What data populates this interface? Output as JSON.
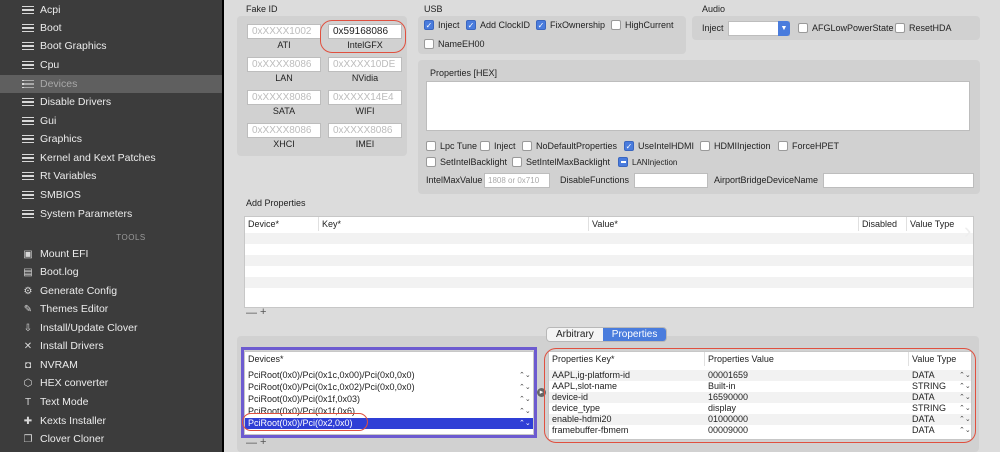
{
  "sidebar": {
    "items": [
      {
        "label": "Acpi",
        "icon": "list-icon"
      },
      {
        "label": "Boot",
        "icon": "list-icon"
      },
      {
        "label": "Boot Graphics",
        "icon": "list-icon"
      },
      {
        "label": "Cpu",
        "icon": "list-icon"
      },
      {
        "label": "Devices",
        "icon": "list-icon",
        "selected": true
      },
      {
        "label": "Disable Drivers",
        "icon": "list-icon"
      },
      {
        "label": "Gui",
        "icon": "list-icon"
      },
      {
        "label": "Graphics",
        "icon": "list-icon"
      },
      {
        "label": "Kernel and Kext Patches",
        "icon": "list-icon"
      },
      {
        "label": "Rt Variables",
        "icon": "list-icon"
      },
      {
        "label": "SMBIOS",
        "icon": "list-icon"
      },
      {
        "label": "System Parameters",
        "icon": "list-icon"
      }
    ],
    "tools_header": "TOOLS",
    "tools": [
      {
        "label": "Mount EFI",
        "icon": "disk-icon"
      },
      {
        "label": "Boot.log",
        "icon": "log-icon"
      },
      {
        "label": "Generate Config",
        "icon": "gear-icon"
      },
      {
        "label": "Themes Editor",
        "icon": "brush-icon"
      },
      {
        "label": "Install/Update Clover",
        "icon": "download-icon"
      },
      {
        "label": "Install Drivers",
        "icon": "tools-icon"
      },
      {
        "label": "NVRAM",
        "icon": "chip-icon"
      },
      {
        "label": "HEX converter",
        "icon": "hex-icon"
      },
      {
        "label": "Text Mode",
        "icon": "text-icon"
      },
      {
        "label": "Kexts Installer",
        "icon": "puzzle-icon"
      },
      {
        "label": "Clover Cloner",
        "icon": "clone-icon"
      }
    ]
  },
  "fake_id": {
    "title": "Fake ID",
    "fields": [
      {
        "value": "0xXXXX1002",
        "label": "ATI",
        "filled": false
      },
      {
        "value": "0x59168086",
        "label": "IntelGFX",
        "filled": true
      },
      {
        "value": "0xXXXX8086",
        "label": "LAN",
        "filled": false
      },
      {
        "value": "0xXXXX10DE",
        "label": "NVidia",
        "filled": false
      },
      {
        "value": "0xXXXX8086",
        "label": "SATA",
        "filled": false
      },
      {
        "value": "0xXXXX14E4",
        "label": "WIFI",
        "filled": false
      },
      {
        "value": "0xXXXX8086",
        "label": "XHCI",
        "filled": false
      },
      {
        "value": "0xXXXX8086",
        "label": "IMEI",
        "filled": false
      }
    ]
  },
  "usb": {
    "title": "USB",
    "options": [
      {
        "label": "Inject",
        "checked": true
      },
      {
        "label": "Add ClockID",
        "checked": true
      },
      {
        "label": "FixOwnership",
        "checked": true
      },
      {
        "label": "HighCurrent",
        "checked": false
      },
      {
        "label": "NameEH00",
        "checked": false
      }
    ]
  },
  "audio": {
    "title": "Audio",
    "inject_label": "Inject",
    "inject_value": "",
    "options": [
      {
        "label": "AFGLowPowerState",
        "checked": false
      },
      {
        "label": "ResetHDA",
        "checked": false
      }
    ]
  },
  "properties_hex": {
    "title": "Properties [HEX]",
    "value": ""
  },
  "device_flags": [
    {
      "label": "Lpc Tune",
      "state": "off"
    },
    {
      "label": "Inject",
      "state": "off"
    },
    {
      "label": "NoDefaultProperties",
      "state": "off"
    },
    {
      "label": "UseIntelHDMI",
      "state": "on"
    },
    {
      "label": "HDMIInjection",
      "state": "off"
    },
    {
      "label": "ForceHPET",
      "state": "off"
    },
    {
      "label": "SetIntelBacklight",
      "state": "off"
    },
    {
      "label": "SetIntelMaxBacklight",
      "state": "off"
    },
    {
      "label": "LANInjection",
      "state": "mixed"
    }
  ],
  "intel_max_value": {
    "label": "IntelMaxValue",
    "placeholder": "1808 or 0x710"
  },
  "disable_functions": {
    "label": "DisableFunctions",
    "value": ""
  },
  "airport_bridge": {
    "label": "AirportBridgeDeviceName",
    "value": ""
  },
  "add_properties": {
    "title": "Add Properties",
    "columns": [
      "Device*",
      "Key*",
      "Value*",
      "Disabled",
      "Value Type"
    ],
    "add_symbol": "+",
    "remove_symbol": "—"
  },
  "tabs": {
    "arbitrary": "Arbitrary",
    "properties": "Properties",
    "active": "properties"
  },
  "devices_table": {
    "header": "Devices*",
    "rows": [
      "PciRoot(0x0)/Pci(0x1c,0x00)/Pci(0x0,0x0)",
      "PciRoot(0x0)/Pci(0x1c,0x02)/Pci(0x0,0x0)",
      "PciRoot(0x0)/Pci(0x1f,0x03)",
      "PciRoot(0x0)/Pci(0x1f,0x6)",
      "PciRoot(0x0)/Pci(0x2,0x0)"
    ],
    "selected_index": 4
  },
  "props_table": {
    "columns": [
      "Properties Key*",
      "Properties Value",
      "Value Type"
    ],
    "rows": [
      {
        "key": "AAPL,ig-platform-id",
        "value": "00001659",
        "type": "DATA"
      },
      {
        "key": "AAPL,slot-name",
        "value": "Built-in",
        "type": "STRING"
      },
      {
        "key": "device-id",
        "value": "16590000",
        "type": "DATA"
      },
      {
        "key": "device_type",
        "value": "display",
        "type": "STRING"
      },
      {
        "key": "enable-hdmi20",
        "value": "01000000",
        "type": "DATA"
      },
      {
        "key": "framebuffer-fbmem",
        "value": "00009000",
        "type": "DATA"
      }
    ]
  },
  "colors": {
    "sidebar_bg": "#3c3c3c",
    "accent": "#4a7cdd",
    "highlight_red": "#e0503f",
    "highlight_purple": "#6d5bd0"
  }
}
